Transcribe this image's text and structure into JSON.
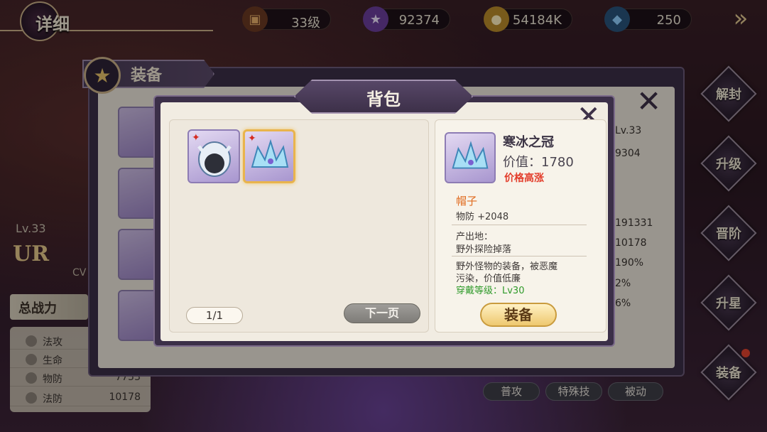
{
  "header": {
    "title": "详细",
    "level": "33级",
    "currency_a": "92374",
    "currency_b": "54184K",
    "gems": "250",
    "icons": [
      "chest-icon",
      "medal-icon",
      "coin-icon",
      "diamond-icon",
      "exit-icon"
    ]
  },
  "hero": {
    "level": "Lv.33",
    "rarity": "UR",
    "cv": "CV",
    "power_label": "总战力",
    "stats": [
      {
        "name": "法攻",
        "value": ""
      },
      {
        "name": "生命",
        "value": ""
      },
      {
        "name": "物防",
        "value": "7753"
      },
      {
        "name": "法防",
        "value": "10178"
      }
    ]
  },
  "equip_panel": {
    "tab_label": "装备",
    "right_level": "Lv.33",
    "right_stats": [
      "9304",
      "191331",
      "10178",
      "190%",
      "2%",
      "6%"
    ],
    "skills": [
      "普攻",
      "特殊技",
      "被动"
    ]
  },
  "side_menu": [
    "解封",
    "升级",
    "晋阶",
    "升星",
    "装备"
  ],
  "bag": {
    "title": "背包",
    "page": "1/1",
    "next_page": "下一页",
    "items": [
      {
        "icon": "helmet-icon",
        "rank": "✦"
      },
      {
        "icon": "ice-crown-icon",
        "rank": "✦"
      }
    ]
  },
  "detail": {
    "name": "寒冰之冠",
    "value": "价值：1780",
    "price_tag": "价格高涨",
    "type": "帽子",
    "attribute": "物防 +2048",
    "origin_label": "产出地：",
    "origin": "野外探险掉落",
    "desc_line1": "野外怪物的装备，被恶魔",
    "desc_line2": "污染，价值低廉",
    "wear_level": "穿戴等级：Lv30",
    "equip_button": "装备"
  },
  "colors": {
    "accent_gold": "#e9c46a",
    "price_red": "#e33d2b",
    "type_orange": "#e06a1e",
    "level_green": "#2f9a2a"
  }
}
